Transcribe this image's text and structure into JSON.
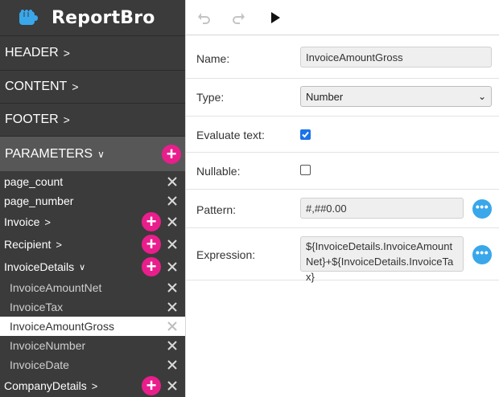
{
  "app": {
    "title": "ReportBro"
  },
  "sidebar": {
    "sections": {
      "header": "HEADER",
      "content": "CONTENT",
      "footer": "FOOTER",
      "parameters": "PARAMETERS"
    },
    "params": [
      "page_count",
      "page_number",
      "Invoice",
      "Recipient",
      "InvoiceDetails",
      "InvoiceAmountNet",
      "InvoiceTax",
      "InvoiceAmountGross",
      "InvoiceNumber",
      "InvoiceDate",
      "CompanyDetails"
    ]
  },
  "properties": {
    "name_label": "Name:",
    "name_value": "InvoiceAmountGross",
    "type_label": "Type:",
    "type_value": "Number",
    "evaluate_label": "Evaluate text:",
    "evaluate_checked": true,
    "nullable_label": "Nullable:",
    "nullable_checked": false,
    "pattern_label": "Pattern:",
    "pattern_value": "#,##0.00",
    "expression_label": "Expression:",
    "expression_value": "${InvoiceDetails.InvoiceAmountNet}+${InvoiceDetails.InvoiceTax}"
  },
  "colors": {
    "accent_pink": "#e91e8c",
    "accent_blue": "#39a7ea",
    "sidebar_bg": "#3b3b3b"
  }
}
